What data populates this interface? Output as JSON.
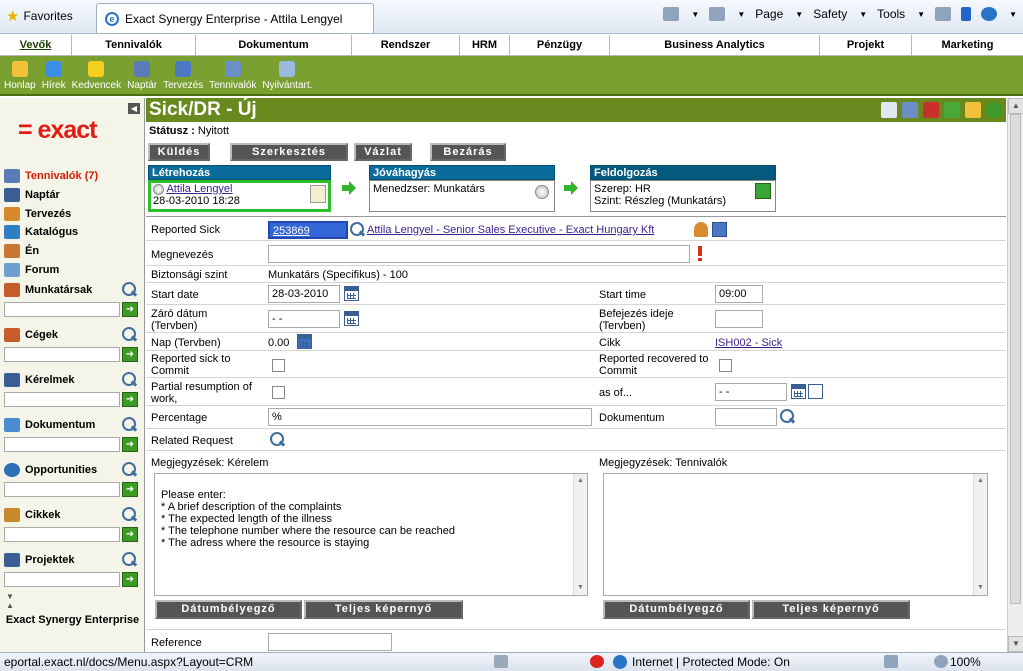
{
  "browser": {
    "favorites": "Favorites",
    "tab_title": "Exact Synergy Enterprise - Attila Lengyel",
    "commands": [
      "Page",
      "Safety",
      "Tools"
    ]
  },
  "menu": [
    "Vevők",
    "Tennivalók",
    "Dokumentum",
    "Rendszer",
    "HRM",
    "Pénzügy",
    "Business Analytics",
    "Projekt",
    "Marketing"
  ],
  "toolbar": [
    "Honlap",
    "Hírek",
    "Kedvencek",
    "Naptár",
    "Tervezés",
    "Tennivalók",
    "Nyilvántart."
  ],
  "sidebar": {
    "logo": "= exact",
    "items": [
      "Tennivalók (7)",
      "Naptár",
      "Tervezés",
      "Katalógus",
      "Én",
      "Forum"
    ],
    "search_sections": [
      "Munkatársak",
      "Cégek",
      "Kérelmek",
      "Dokumentum",
      "Opportunities",
      "Cikkek",
      "Projektek"
    ],
    "footer": "Exact Synergy Enterprise"
  },
  "page": {
    "title": "Sick/DR - Új",
    "status_label": "Státusz :",
    "status_value": "Nyitott",
    "buttons": [
      "Küldés",
      "Szerkesztés",
      "Vázlat",
      "Bezárás"
    ]
  },
  "workflow": {
    "created": {
      "title": "Létrehozás",
      "user": "Attila Lengyel",
      "date": "28-03-2010 18:28"
    },
    "approval": {
      "title": "Jóváhagyás",
      "text": "Menedzser: Munkatárs"
    },
    "processing": {
      "title": "Feldolgozás",
      "role": "Szerep: HR",
      "level": "Szint: Részleg (Munkatárs)"
    }
  },
  "form": {
    "reported_sick_label": "Reported Sick",
    "reported_sick_value": "253869",
    "reported_sick_link": "Attila Lengyel - Senior Sales Executive - Exact Hungary Kft",
    "name_label": "Megnevezés",
    "security_label": "Biztonsági szint",
    "security_value": "Munkatárs (Specifikus) - 100",
    "start_date_label": "Start date",
    "start_date_value": "28-03-2010",
    "start_time_label": "Start time",
    "start_time_value": "09:00",
    "end_date_label": "Záró dátum (Tervben)",
    "end_date_value": "- -",
    "end_time_label": "Befejezés ideje (Tervben)",
    "days_label": "Nap (Tervben)",
    "days_value": "0.00",
    "item_label": "Cikk",
    "item_value": "ISH002 - Sick",
    "reported_commit_label": "Reported sick to Commit",
    "recovered_label": "Reported recovered to Commit",
    "partial_label": "Partial resumption of work,",
    "as_of_label": "as of...",
    "as_of_value": "- -",
    "percentage_label": "Percentage",
    "percentage_value": "%",
    "document_label": "Dokumentum",
    "related_label": "Related Request",
    "notes_request_label": "Megjegyzések: Kérelem",
    "notes_request_text": "Please enter:\n* A brief description of the complaints\n* The expected length of the illness\n* The telephone number where the resource can be reached\n* The adress where the resource is staying",
    "notes_todo_label": "Megjegyzések: Tennivalók",
    "stamp_button": "Dátumbélyegző",
    "fullscreen_button": "Teljes képernyő",
    "reference_label": "Reference"
  },
  "statusbar": {
    "url": "eportal.exact.nl/docs/Menu.aspx?Layout=CRM",
    "zone": "Internet | Protected Mode: On",
    "zoom": "100%"
  },
  "colors": {
    "accent_green": "#68891e",
    "workflow_header": "#0b6c9b",
    "exact_red": "#e31b13"
  }
}
